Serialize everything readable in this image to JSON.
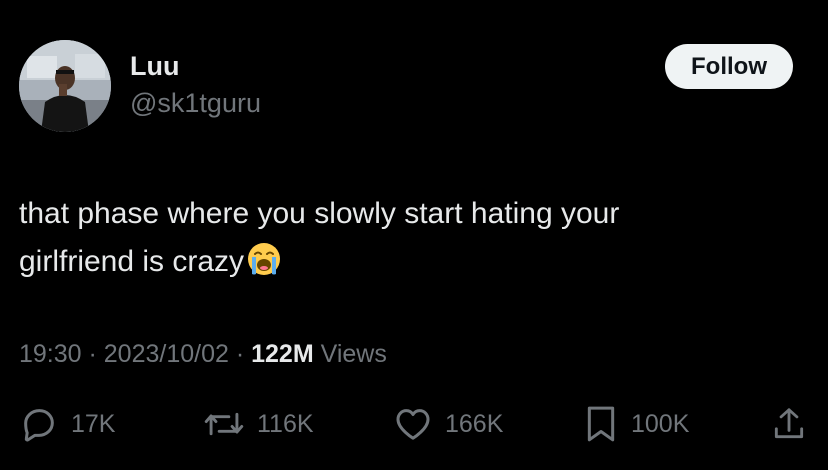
{
  "author": {
    "display_name": "Luu",
    "handle": "@sk1tguru"
  },
  "follow_button": {
    "label": "Follow"
  },
  "tweet": {
    "text_line1": "that phase where you slowly start hating your",
    "text_line2": "girlfriend is crazy",
    "emoji": "loudly-crying-face"
  },
  "meta": {
    "time": "19:30",
    "separator": " · ",
    "date": "2023/10/02",
    "views_count": "122M",
    "views_label": " Views"
  },
  "actions": {
    "replies": {
      "icon": "reply-icon",
      "count": "17K"
    },
    "reposts": {
      "icon": "repost-icon",
      "count": "116K"
    },
    "likes": {
      "icon": "heart-icon",
      "count": "166K"
    },
    "bookmarks": {
      "icon": "bookmark-icon",
      "count": "100K"
    },
    "share": {
      "icon": "share-icon"
    }
  },
  "colors": {
    "background": "#000000",
    "text_primary": "#e7e9ea",
    "text_secondary": "#71767b",
    "follow_bg": "#eff3f4"
  }
}
